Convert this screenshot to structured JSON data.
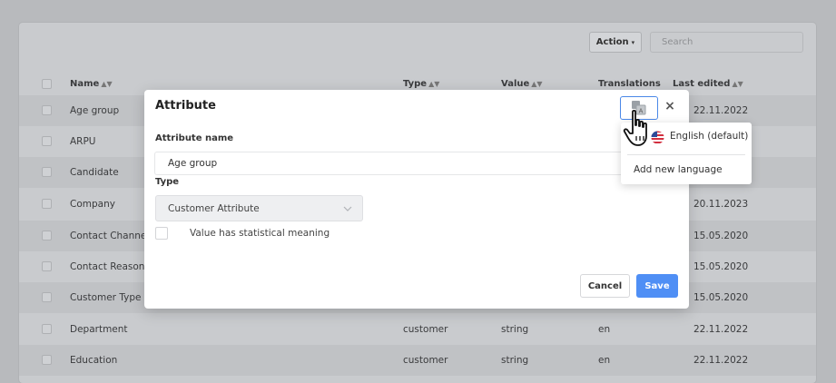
{
  "toolbar": {
    "action_label": "Action",
    "search_placeholder": "Search"
  },
  "table": {
    "columns": [
      "Name",
      "Type",
      "Value",
      "Translations",
      "Last edited"
    ],
    "rows": [
      {
        "name": "Age group",
        "type": "",
        "value": "",
        "translations": "",
        "last_edited": "22.11.2022"
      },
      {
        "name": "ARPU",
        "type": "",
        "value": "",
        "translations": "",
        "last_edited": ""
      },
      {
        "name": "Candidate",
        "type": "",
        "value": "",
        "translations": "",
        "last_edited": ""
      },
      {
        "name": "Company",
        "type": "",
        "value": "",
        "translations": "",
        "last_edited": "20.11.2023"
      },
      {
        "name": "Contact Channel",
        "type": "",
        "value": "",
        "translations": "",
        "last_edited": "15.05.2020"
      },
      {
        "name": "Contact Reason",
        "type": "",
        "value": "",
        "translations": "",
        "last_edited": "15.05.2020"
      },
      {
        "name": "Customer Type",
        "type": "",
        "value": "",
        "translations": "",
        "last_edited": "15.05.2020"
      },
      {
        "name": "Department",
        "type": "customer",
        "value": "string",
        "translations": "en",
        "last_edited": "22.11.2022"
      },
      {
        "name": "Education",
        "type": "customer",
        "value": "string",
        "translations": "en",
        "last_edited": "22.11.2022"
      }
    ]
  },
  "modal": {
    "title": "Attribute",
    "name_label": "Attribute name",
    "name_value": "Age group",
    "type_label": "Type",
    "type_value": "Customer Attribute",
    "stat_label": "Value has statistical meaning",
    "cancel_label": "Cancel",
    "save_label": "Save"
  },
  "language_menu": {
    "items": [
      "English (default)",
      "Add new language"
    ]
  },
  "colors": {
    "accent": "#4f8ff5",
    "overlay": "#b8babd"
  }
}
